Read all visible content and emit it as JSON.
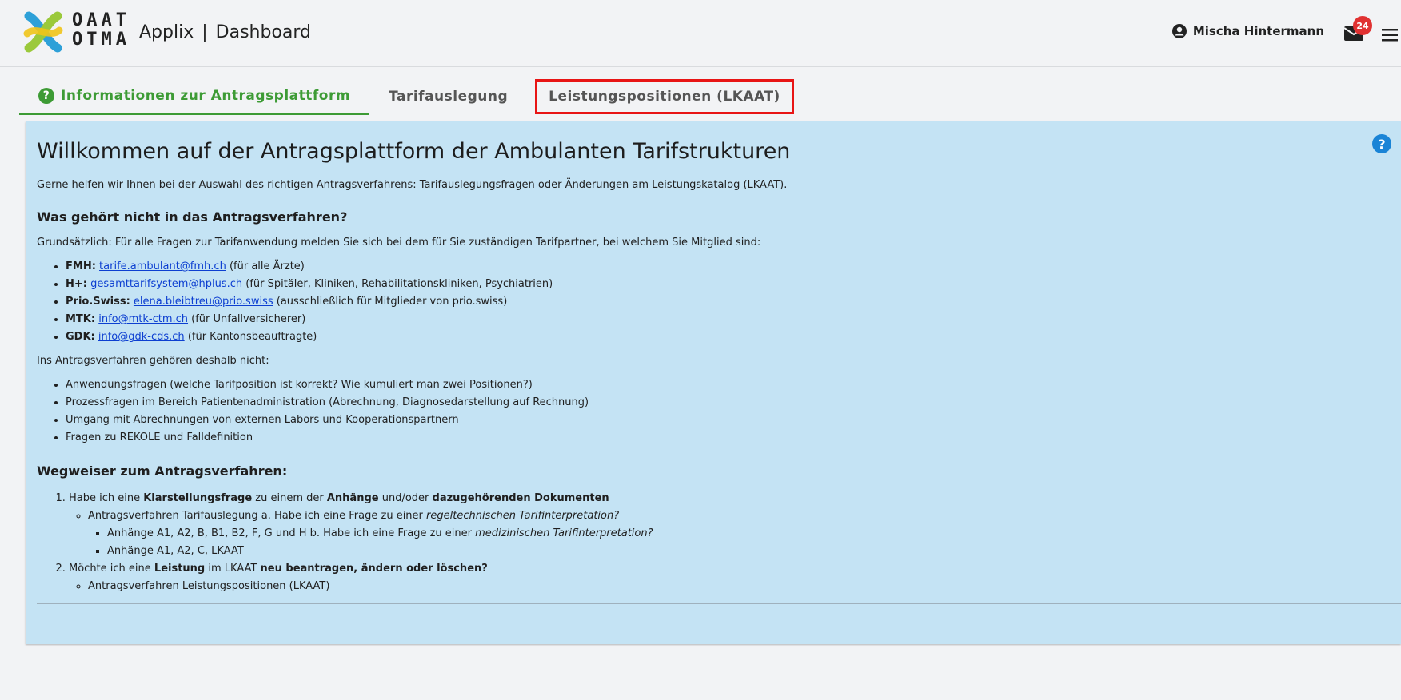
{
  "header": {
    "logo_line1": "OAAT",
    "logo_line2": "OTMA",
    "app_name": "Applix",
    "separator": "|",
    "page": "Dashboard",
    "user_name": "Mischa Hintermann",
    "mail_count": "24"
  },
  "tabs": [
    {
      "label": "Informationen zur Antragsplattform",
      "active": true
    },
    {
      "label": "Tarifauslegung",
      "active": false
    },
    {
      "label": "Leistungspositionen (LKAAT)",
      "active": false
    }
  ],
  "panel": {
    "title": "Willkommen auf der Antragsplattform der Ambulanten Tarifstrukturen",
    "intro": "Gerne helfen wir Ihnen bei der Auswahl des richtigen Antragsverfahrens: Tarifauslegungsfragen oder Änderungen am Leistungskatalog (LKAAT).",
    "section1": {
      "heading": "Was gehört nicht in das Antragsverfahren?",
      "text": "Grundsätzlich: Für alle Fragen zur Tarifanwendung melden Sie sich bei dem für Sie zuständigen Tarifpartner, bei welchem Sie Mitglied sind:",
      "contacts": [
        {
          "org": "FMH:",
          "email": "tarife.ambulant@fmh.ch",
          "note": "(für alle Ärzte)"
        },
        {
          "org": "H+:",
          "email": "gesamttarifsystem@hplus.ch",
          "note": "(für Spitäler, Kliniken, Rehabilitationskliniken, Psychiatrien)"
        },
        {
          "org": "Prio.Swiss:",
          "email": "elena.bleibtreu@prio.swiss",
          "note": "(ausschließlich für Mitglieder von prio.swiss)"
        },
        {
          "org": "MTK:",
          "email": "info@mtk-ctm.ch",
          "note": "(für Unfallversicherer)"
        },
        {
          "org": "GDK:",
          "email": "info@gdk-cds.ch",
          "note": "(für Kantonsbeauftragte)"
        }
      ],
      "not_included_intro": "Ins Antragsverfahren gehören deshalb nicht:",
      "not_included": [
        "Anwendungsfragen (welche Tarifposition ist korrekt? Wie kumuliert man zwei Positionen?)",
        "Prozessfragen im Bereich Patientenadministration (Abrechnung, Diagnosedarstellung auf Rechnung)",
        "Umgang mit Abrechnungen von externen Labors und Kooperationspartnern",
        "Fragen zu REKOLE und Falldefinition"
      ]
    },
    "section2": {
      "heading": "Wegweiser zum Antragsverfahren:",
      "item1": {
        "t1": "Habe ich eine ",
        "b1": "Klarstellungsfrage",
        "t2": " zu einem der ",
        "b2": "Anhänge",
        "t3": " und/oder ",
        "b3": "dazugehörenden Dokumenten",
        "sub": {
          "text": "Antragsverfahren Tarifauslegung a. Habe ich eine Frage zu einer ",
          "italic": "regeltechnischen Tarifinterpretation?",
          "subsub": [
            {
              "text": "Anhänge A1, A2, B, B1, B2, F, G und H b. Habe ich eine Frage zu einer ",
              "italic": "medizinischen Tarifinterpretation?"
            },
            {
              "text": "Anhänge A1, A2, C, LKAAT",
              "italic": ""
            }
          ]
        }
      },
      "item2": {
        "t1": "Möchte ich eine ",
        "b1": "Leistung",
        "t2": " im LKAAT ",
        "b2": "neu beantragen, ändern oder löschen?",
        "sub": "Antragsverfahren Leistungspositionen (LKAAT)"
      }
    }
  },
  "colors": {
    "accent_green": "#3d9b35",
    "panel_bg": "#c4e3f4",
    "highlight_red": "#e81515",
    "badge_red": "#e03131",
    "help_blue": "#1a84d6"
  },
  "icons": [
    "logo-icon",
    "user-icon",
    "mail-icon",
    "hamburger-icon",
    "question-icon",
    "help-icon"
  ]
}
